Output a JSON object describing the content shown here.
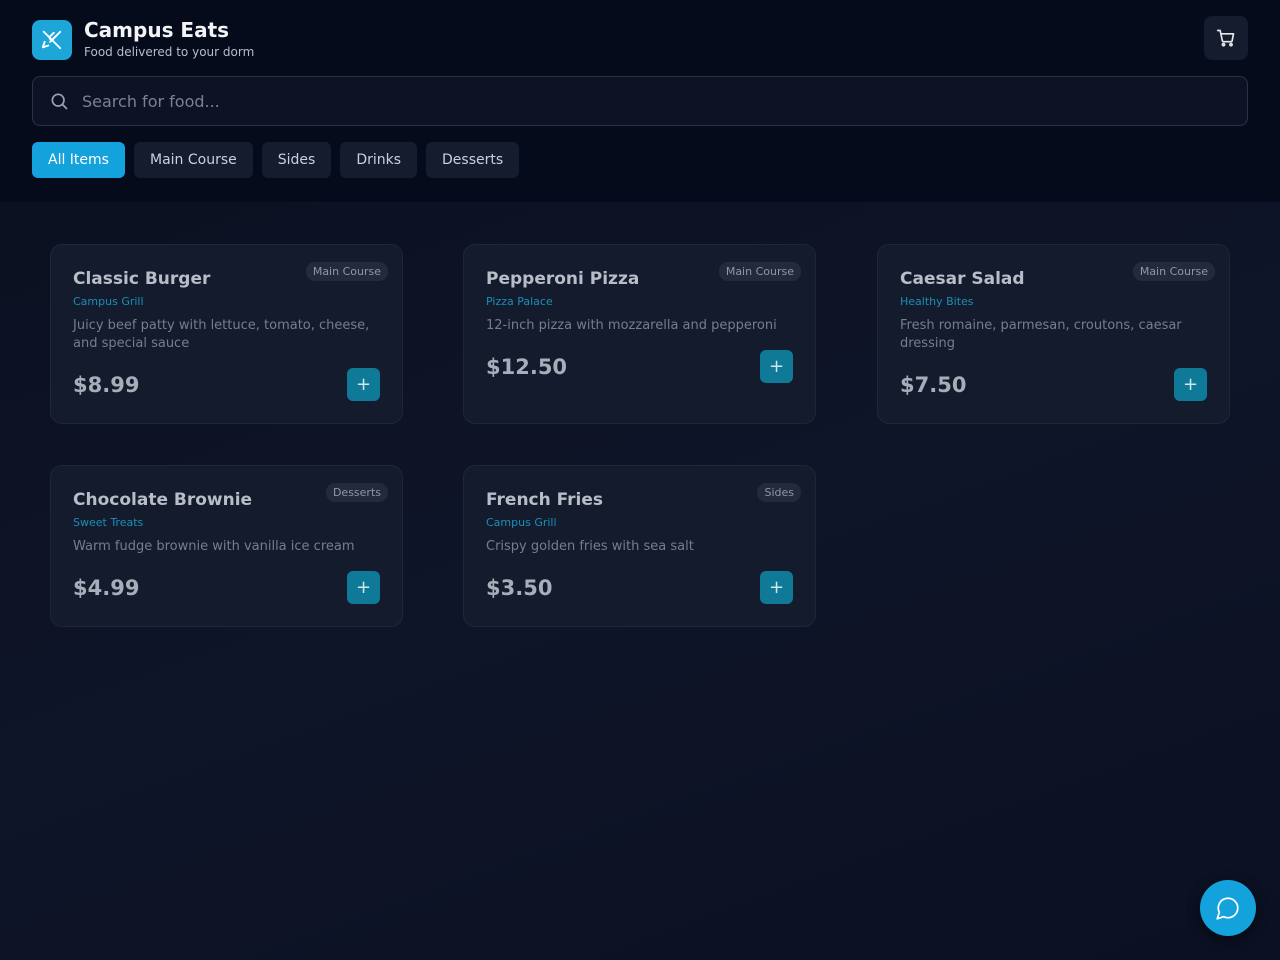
{
  "app": {
    "title": "Campus Eats",
    "subtitle": "Food delivered to your dorm",
    "logo_icon": "utensils-icon"
  },
  "header": {
    "cart_icon": "shopping-cart-icon"
  },
  "search": {
    "placeholder": "Search for food...",
    "value": ""
  },
  "tabs": [
    {
      "label": "All Items",
      "active": true
    },
    {
      "label": "Main Course",
      "active": false
    },
    {
      "label": "Sides",
      "active": false
    },
    {
      "label": "Drinks",
      "active": false
    },
    {
      "label": "Desserts",
      "active": false
    }
  ],
  "items": [
    {
      "name": "Classic Burger",
      "vendor": "Campus Grill",
      "category": "Main Course",
      "description": "Juicy beef patty with lettuce, tomato, cheese, and special sauce",
      "price": "$8.99"
    },
    {
      "name": "Pepperoni Pizza",
      "vendor": "Pizza Palace",
      "category": "Main Course",
      "description": "12-inch pizza with mozzarella and pepperoni",
      "price": "$12.50"
    },
    {
      "name": "Caesar Salad",
      "vendor": "Healthy Bites",
      "category": "Main Course",
      "description": "Fresh romaine, parmesan, croutons, caesar dressing",
      "price": "$7.50"
    },
    {
      "name": "Chocolate Brownie",
      "vendor": "Sweet Treats",
      "category": "Desserts",
      "description": "Warm fudge brownie with vanilla ice cream",
      "price": "$4.99"
    },
    {
      "name": "French Fries",
      "vendor": "Campus Grill",
      "category": "Sides",
      "description": "Crispy golden fries with sea salt",
      "price": "$3.50"
    }
  ],
  "add_button_label": "+",
  "chat_icon": "chat-bubble-icon",
  "colors": {
    "accent": "#14a2dc",
    "background": "#0b1020",
    "card": "#141b2c",
    "vendor_text": "#1a8fb8"
  }
}
